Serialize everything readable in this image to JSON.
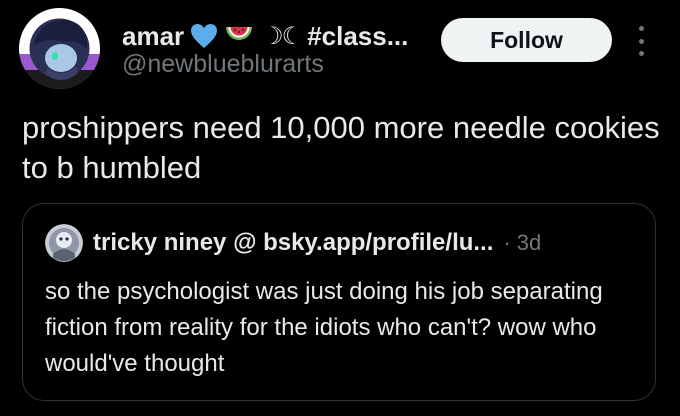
{
  "author": {
    "display_name": "amar",
    "name_suffix": "#class...",
    "name_emojis": [
      "blue-heart",
      "watermelon",
      "crescent-moons"
    ],
    "moon_glyph": "☽☾",
    "handle": "@newblueblurarts",
    "avatar_icon": "avatar-icon"
  },
  "follow_button": {
    "label": "Follow"
  },
  "tweet": {
    "text": "proshippers need 10,000 more needle cookies to b humbled"
  },
  "quote": {
    "author_name": "tricky niney @ bsky.app/profile/lu...",
    "separator": "·",
    "time": "3d",
    "text": "so the psychologist was just doing his job separating fiction from reality for the idiots who can't? wow who would've thought"
  },
  "colors": {
    "background": "#000000",
    "text_primary": "#e7e9ea",
    "text_secondary": "#71767b",
    "follow_bg": "#eff3f4",
    "border": "#2f3336"
  }
}
